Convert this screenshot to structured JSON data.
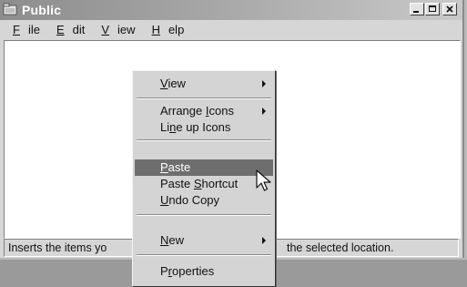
{
  "window": {
    "title": "Public"
  },
  "menubar": [
    {
      "label": "File",
      "key": "F",
      "rest": "ile"
    },
    {
      "label": "Edit",
      "key": "E",
      "rest": "dit"
    },
    {
      "label": "View",
      "key": "V",
      "rest": "iew"
    },
    {
      "label": "Help",
      "key": "H",
      "rest": "elp"
    }
  ],
  "context_menu": {
    "items": [
      {
        "label": "View",
        "pre": "",
        "key": "V",
        "post": "iew",
        "submenu": true
      },
      {
        "label": "Arrange Icons",
        "pre": "Arrange ",
        "key": "I",
        "post": "cons",
        "submenu": true
      },
      {
        "label": "Line up Icons",
        "pre": "Li",
        "key": "n",
        "post": "e up Icons",
        "submenu": false
      },
      {
        "label": "Paste",
        "pre": "",
        "key": "P",
        "post": "aste",
        "submenu": false,
        "highlighted": true
      },
      {
        "label": "Paste Shortcut",
        "pre": "Paste ",
        "key": "S",
        "post": "hortcut",
        "submenu": false
      },
      {
        "label": "Undo Copy",
        "pre": "",
        "key": "U",
        "post": "ndo Copy",
        "submenu": false
      },
      {
        "label": "New",
        "pre": "",
        "key": "N",
        "post": "ew",
        "submenu": true
      },
      {
        "label": "Properties",
        "pre": "P",
        "key": "r",
        "post": "operties",
        "submenu": false
      }
    ]
  },
  "statusbar": {
    "left_text": "Inserts the items yo",
    "right_text": "the selected location."
  },
  "icons": {
    "window_icon": "folder-icon",
    "minimize": "minimize-icon",
    "maximize": "maximize-icon",
    "close": "close-icon",
    "cursor": "mouse-pointer-icon"
  },
  "colors": {
    "highlight": "#6e6e6e",
    "menu_bg": "#d4d4d4",
    "title_start": "#8d8d8d"
  }
}
